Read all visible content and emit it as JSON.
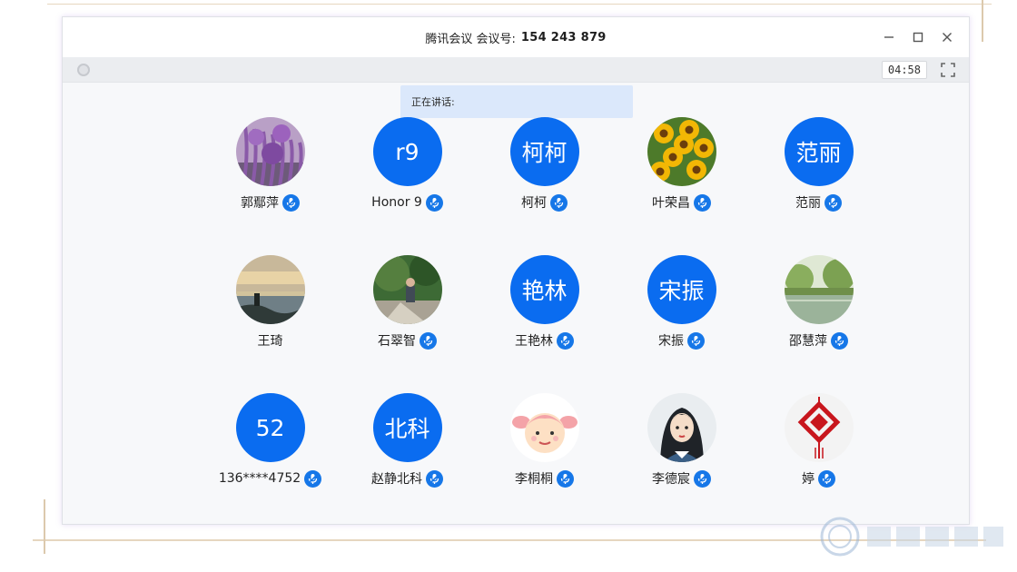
{
  "window": {
    "title_app": "腾讯会议 会议号:",
    "meeting_number": "154 243 879",
    "timer": "04:58",
    "speaking_label": "正在讲话:"
  },
  "participants": [
    {
      "name": "郭鄢萍",
      "avatar_type": "photo",
      "photo": "lavender-flowers"
    },
    {
      "name": "Honor 9",
      "avatar_type": "text",
      "avatar_text": "r9"
    },
    {
      "name": "柯柯",
      "avatar_type": "text",
      "avatar_text": "柯柯"
    },
    {
      "name": "叶荣昌",
      "avatar_type": "photo",
      "photo": "sunflowers"
    },
    {
      "name": "范丽",
      "avatar_type": "text",
      "avatar_text": "范丽"
    },
    {
      "name": "王琦",
      "avatar_type": "photo",
      "photo": "sunset-lake",
      "muted_icon": false
    },
    {
      "name": "石翠智",
      "avatar_type": "photo",
      "photo": "garden-person"
    },
    {
      "name": "王艳林",
      "avatar_type": "text",
      "avatar_text": "艳林"
    },
    {
      "name": "宋振",
      "avatar_type": "text",
      "avatar_text": "宋振"
    },
    {
      "name": "邵慧萍",
      "avatar_type": "photo",
      "photo": "park-pond"
    },
    {
      "name": "136****4752",
      "avatar_type": "text",
      "avatar_text": "52"
    },
    {
      "name": "赵静北科",
      "avatar_type": "text",
      "avatar_text": "北科"
    },
    {
      "name": "李桐桐",
      "avatar_type": "photo",
      "photo": "cartoon-girl"
    },
    {
      "name": "李德宸",
      "avatar_type": "photo",
      "photo": "cartoon-woman"
    },
    {
      "name": "婷",
      "avatar_type": "photo",
      "photo": "chinese-knot"
    }
  ],
  "colors": {
    "avatar_blue": "#0a6cf0",
    "mic_blue": "#1677e8",
    "speaking_bg": "#dbe8fb"
  }
}
